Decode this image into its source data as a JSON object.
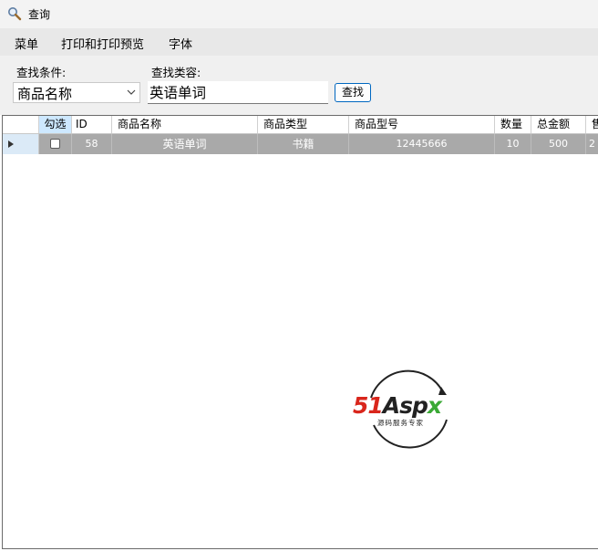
{
  "window": {
    "title": "查询",
    "icon": "magnifier-icon"
  },
  "menu": {
    "items": [
      "菜单",
      "打印和打印预览",
      "字体"
    ]
  },
  "search": {
    "condition_label": "查找条件:",
    "condition_value": "商品名称",
    "content_label": "查找类容:",
    "content_value": "英语单词",
    "button_label": "查找"
  },
  "grid": {
    "columns": [
      "勾选",
      "ID",
      "商品名称",
      "商品类型",
      "商品型号",
      "数量",
      "总金额",
      "售"
    ],
    "rows": [
      {
        "checked": false,
        "id": "58",
        "name": "英语单词",
        "type": "书籍",
        "model": "12445666",
        "qty": "10",
        "total": "500",
        "partial": "2"
      }
    ]
  },
  "watermark": {
    "brand": "51Aspx",
    "tagline": "源码服务专家"
  },
  "colors": {
    "selected_row": "#a9a9a9",
    "header_selected": "#cde8ff",
    "button_border": "#0067c0",
    "brand_red": "#d9261c",
    "brand_green": "#3aa935"
  }
}
